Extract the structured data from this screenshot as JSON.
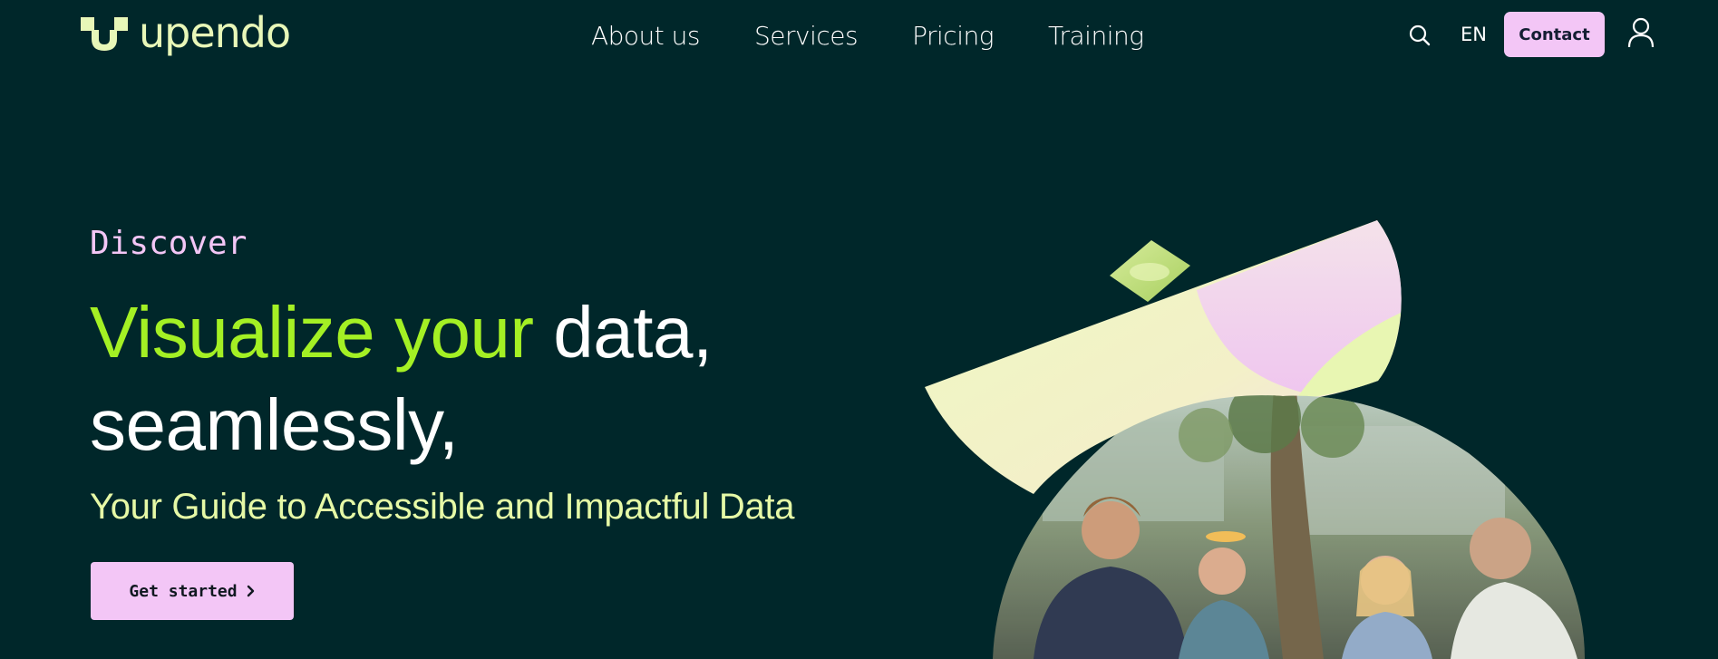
{
  "brand": {
    "name": "upendo",
    "text_color": "#e8f7b8"
  },
  "nav": {
    "items": [
      {
        "label": "About us"
      },
      {
        "label": "Services"
      },
      {
        "label": "Pricing"
      },
      {
        "label": "Training"
      }
    ]
  },
  "header": {
    "search_icon": "search-icon",
    "language": "EN",
    "contact_label": "Contact",
    "user_icon": "user-icon"
  },
  "hero": {
    "eyebrow": "Discover",
    "headline_accent": "Visualize your",
    "headline_rest": " data, seamlessly,",
    "subheadline": "Your Guide to Accessible and Impactful Data",
    "cta_label": "Get started",
    "cta_icon": "chevron-right-icon",
    "image_subject": "four people talking around a table seen through a window"
  },
  "colors": {
    "background": "#00272a",
    "accent_green": "#a4f024",
    "accent_pink": "#f3c6f6",
    "pale_lime": "#e6f9a6",
    "text": "#ffffff"
  }
}
